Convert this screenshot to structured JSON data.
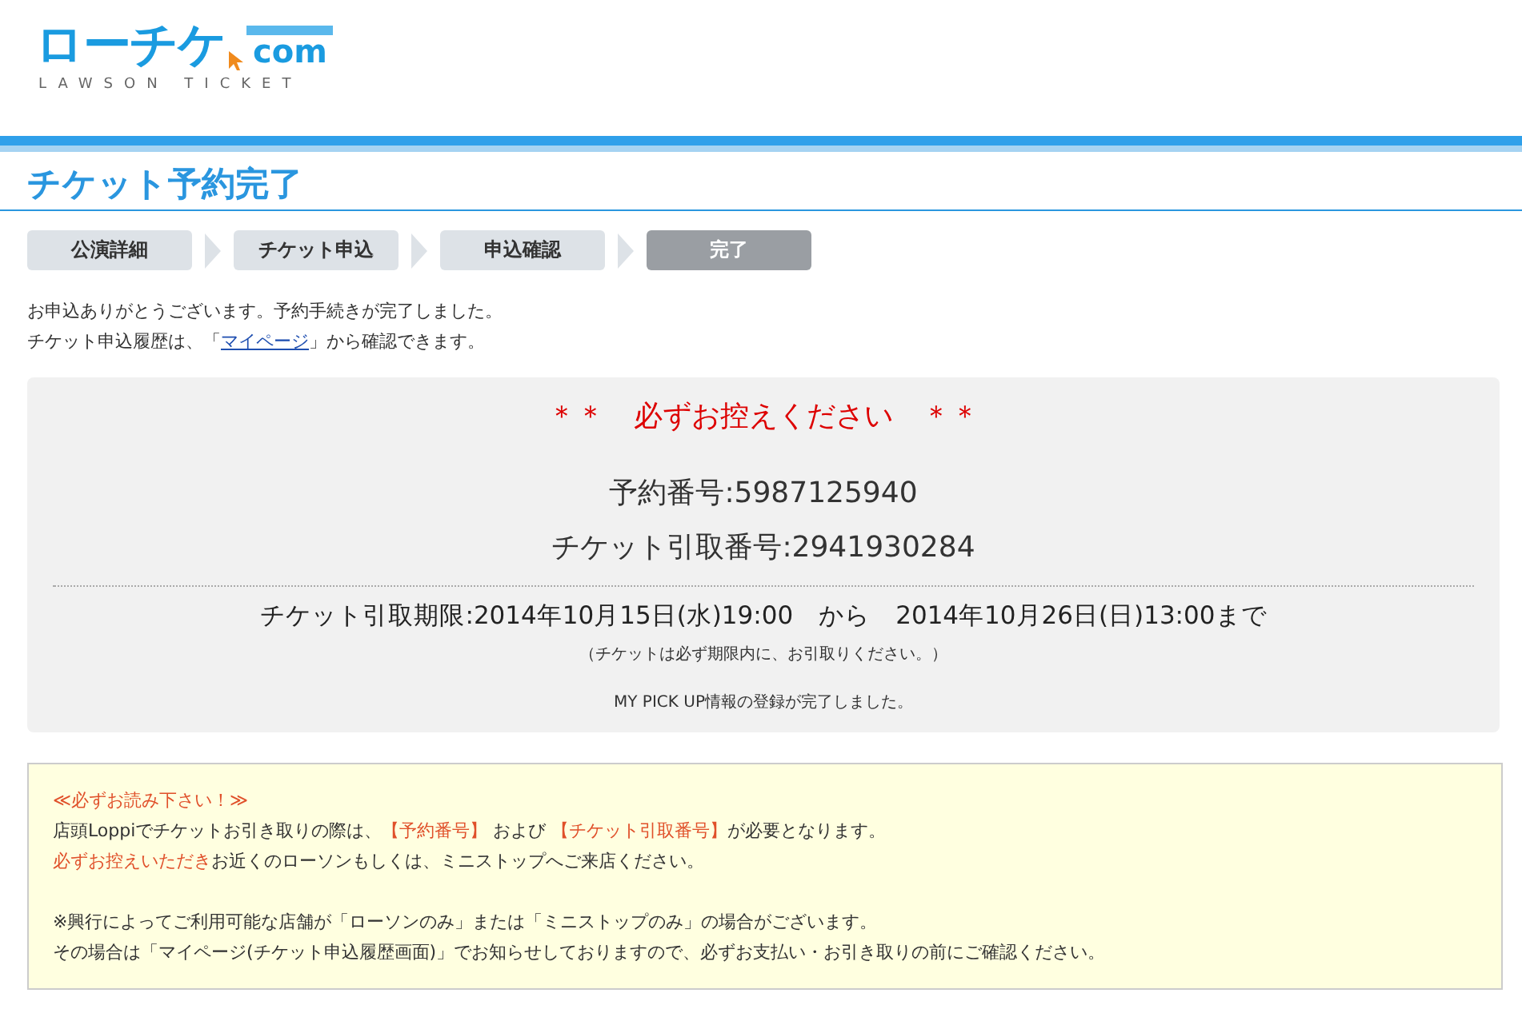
{
  "logo": {
    "title": "ローチケ",
    "suffix": "com",
    "subtitle": "LAWSON TICKET"
  },
  "page_title": "チケット予約完了",
  "steps": [
    {
      "label": "公演詳細",
      "selected": false
    },
    {
      "label": "チケット申込",
      "selected": false
    },
    {
      "label": "申込確認",
      "selected": false
    },
    {
      "label": "完了",
      "selected": true
    }
  ],
  "intro": [
    [
      {
        "text": "お申込ありがとうございます。予約手続きが完了しました。",
        "kind": "plain"
      }
    ],
    [
      {
        "text": "チケット申込履歴は、「",
        "kind": "plain"
      },
      {
        "text": "マイページ",
        "kind": "link"
      },
      {
        "text": "」から確認できます。",
        "kind": "plain"
      }
    ]
  ],
  "summary": {
    "heading": "＊＊　必ずお控えください　＊＊",
    "numbers": [
      "予約番号:5987125940",
      "チケット引取番号:2941930284"
    ],
    "period": "チケット引取期限:2014年10月15日(水)19:00　から　2014年10月26日(日)13:00まで",
    "period_note": "（チケットは必ず期限内に、お引取りください。）",
    "pickup_note": "MY PICK UP情報の登録が完了しました。"
  },
  "notice": [
    [
      [
        {
          "text": "≪必ずお読み下さい！≫",
          "kind": "highlight"
        }
      ],
      [
        {
          "text": "店頭Loppiでチケットお引き取りの際は、",
          "kind": "plain"
        },
        {
          "text": "【予約番号】",
          "kind": "highlight"
        },
        {
          "text": " および ",
          "kind": "plain"
        },
        {
          "text": "【チケット引取番号】",
          "kind": "highlight"
        },
        {
          "text": "が必要となります。",
          "kind": "plain"
        }
      ],
      [
        {
          "text": "必ずお控えいただき",
          "kind": "highlight"
        },
        {
          "text": "お近くのローソンもしくは、ミニストップへご来店ください。",
          "kind": "plain"
        }
      ]
    ],
    [
      [
        {
          "text": "※興行によってご利用可能な店舗が「ローソンのみ」または「ミニストップのみ」の場合がございます。",
          "kind": "plain"
        }
      ],
      [
        {
          "text": "その場合は「マイページ(チケット申込履歴画面)」でお知らせしておりますので、必ずお支払い・お引き取りの前にご確認ください。",
          "kind": "plain"
        }
      ]
    ]
  ]
}
